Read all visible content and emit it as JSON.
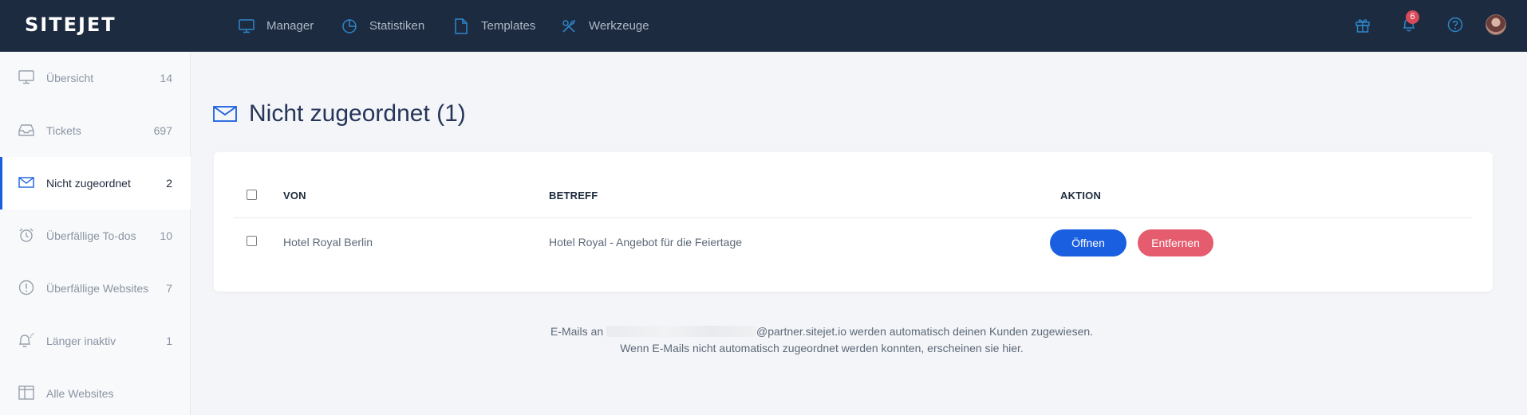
{
  "brand": {
    "logo_text": "SITEJET",
    "accent": "#1a5fe0",
    "danger": "#e45c6e",
    "topbar_bg": "#1c2b40"
  },
  "topnav": {
    "items": [
      {
        "label": "Manager",
        "icon": "monitor-icon"
      },
      {
        "label": "Statistiken",
        "icon": "pie-chart-icon"
      },
      {
        "label": "Templates",
        "icon": "document-icon"
      },
      {
        "label": "Werkzeuge",
        "icon": "tools-icon"
      }
    ],
    "right_icons": [
      "gift-icon",
      "bell-icon",
      "help-icon",
      "avatar"
    ],
    "notification_count": "6"
  },
  "sidebar": {
    "items": [
      {
        "label": "Übersicht",
        "count": "14",
        "icon": "monitor-icon"
      },
      {
        "label": "Tickets",
        "count": "697",
        "icon": "inbox-icon"
      },
      {
        "label": "Nicht zugeordnet",
        "count": "2",
        "icon": "envelope-icon",
        "active": true
      },
      {
        "label": "Überfällige To-dos",
        "count": "10",
        "icon": "alarm-clock-icon"
      },
      {
        "label": "Überfällige Websites",
        "count": "7",
        "icon": "alert-circle-icon"
      },
      {
        "label": "Länger inaktiv",
        "count": "1",
        "icon": "snooze-bell-icon"
      },
      {
        "label": "Alle Websites",
        "count": "",
        "icon": "layout-icon"
      }
    ]
  },
  "main": {
    "title": "Nicht zugeordnet (1)",
    "table": {
      "columns": [
        "VON",
        "BETREFF",
        "AKTION"
      ],
      "rows": [
        {
          "from": "Hotel Royal Berlin",
          "subject": "Hotel Royal - Angebot für die Feiertage",
          "open_label": "Öffnen",
          "remove_label": "Entfernen"
        }
      ]
    },
    "info": {
      "line1_prefix": "E-Mails an",
      "line1_suffix": "@partner.sitejet.io werden automatisch deinen Kunden zugewiesen.",
      "line2": "Wenn E-Mails nicht automatisch zugeordnet werden konnten, erscheinen sie hier."
    }
  }
}
